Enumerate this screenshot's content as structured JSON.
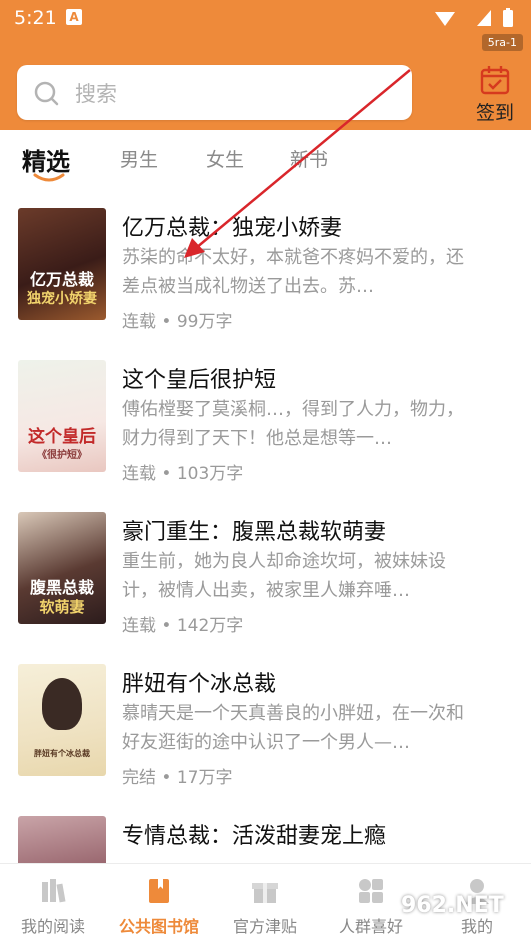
{
  "status": {
    "time": "5:21",
    "badge": "5ra-1"
  },
  "search": {
    "placeholder": "搜索"
  },
  "checkin": {
    "label": "签到"
  },
  "tabs": [
    "精选",
    "男生",
    "女生",
    "新书"
  ],
  "books": [
    {
      "title": "亿万总裁：独宠小娇妻",
      "desc": "苏柒的命不太好，本就爸不疼妈不爱的，还差点被当成礼物送了出去。苏…",
      "status": "连载",
      "words": "99万字",
      "cover_line1": "亿万总裁",
      "cover_line2": "独宠小娇妻"
    },
    {
      "title": "这个皇后很护短",
      "desc": "傅佑樘娶了莫溪桐…，得到了人力，物力，财力得到了天下！他总是想等一…",
      "status": "连载",
      "words": "103万字",
      "cover_line1": "这个皇后",
      "cover_line2": "《很护短》"
    },
    {
      "title": "豪门重生：腹黑总裁软萌妻",
      "desc": "重生前，她为良人却命途坎坷，被妹妹设计，被情人出卖，被家里人嫌弃唾…",
      "status": "连载",
      "words": "142万字",
      "cover_line1": "腹黑总裁",
      "cover_line2": "软萌妻"
    },
    {
      "title": "胖妞有个冰总裁",
      "desc": "慕晴天是一个天真善良的小胖妞，在一次和好友逛街的途中认识了一个男人—…",
      "status": "完结",
      "words": "17万字",
      "cover_line1": "胖妞有个冰总裁",
      "cover_line2": ""
    },
    {
      "title": "专情总裁：活泼甜妻宠上瘾",
      "desc": "",
      "status": "",
      "words": "",
      "cover_line1": "",
      "cover_line2": ""
    }
  ],
  "nav": [
    "我的阅读",
    "公共图书馆",
    "官方津贴",
    "人群喜好",
    "我的"
  ],
  "watermark": "962.NET",
  "colors": {
    "accent": "#ee8a3a",
    "arrow": "#d9262b"
  }
}
